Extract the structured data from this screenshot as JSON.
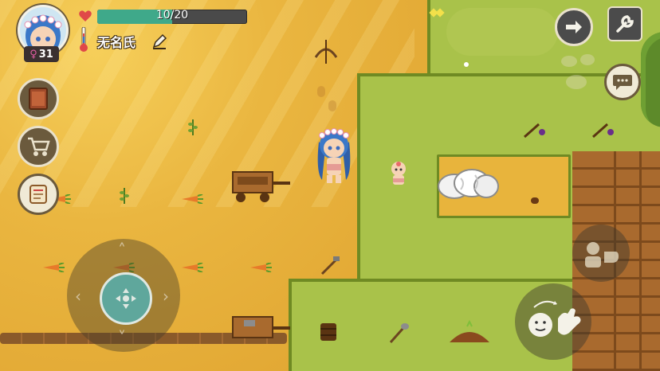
{
  "player": {
    "name": "无名氏",
    "gender_symbol": "♀",
    "level": "31",
    "hp_text": "10/20",
    "hp_fraction": 0.5,
    "hp_color": "#3fa98a"
  },
  "hud": {
    "left_menu": [
      {
        "name": "journal-book",
        "icon": "book-icon"
      },
      {
        "name": "shop",
        "icon": "shopping-cart-icon"
      },
      {
        "name": "quests",
        "icon": "scroll-icon"
      }
    ],
    "top_right": [
      {
        "name": "forward",
        "icon": "arrow-right-icon"
      },
      {
        "name": "settings",
        "icon": "wrench-icon"
      },
      {
        "name": "chat",
        "icon": "speech-bubble-icon"
      }
    ],
    "actions": [
      {
        "name": "emote-wave",
        "icon": "emote-wave-icon"
      },
      {
        "name": "interact",
        "icon": "interact-hand-icon"
      }
    ],
    "joystick": {
      "icon": "dpad-icon"
    }
  },
  "colors": {
    "sand": "#e8b43c",
    "grass": "#a9c24a",
    "grass_edge": "#6f8a23",
    "wood": "#a96a2e"
  }
}
